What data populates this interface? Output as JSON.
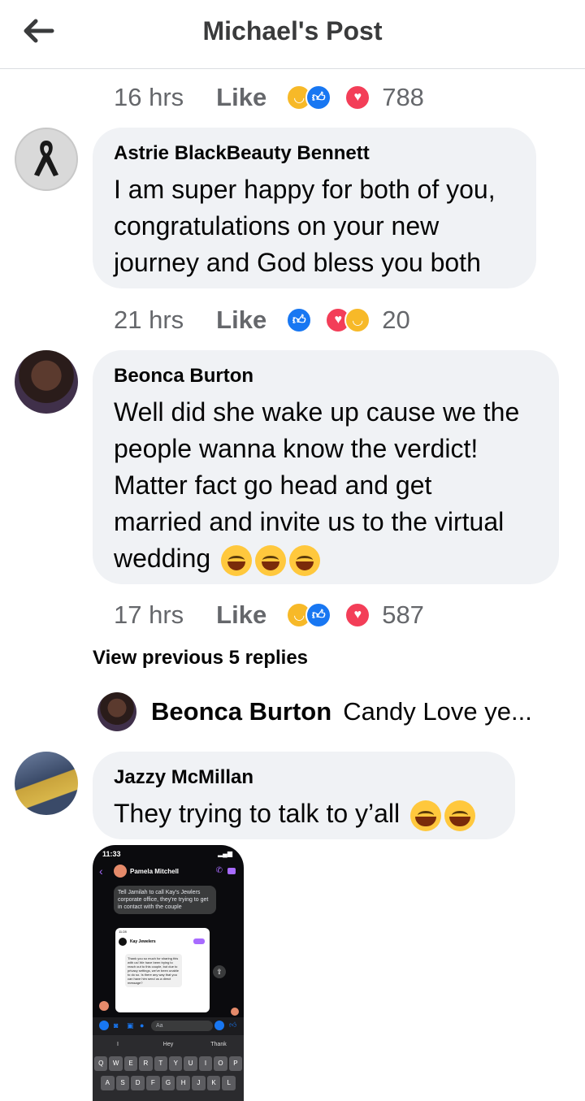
{
  "header": {
    "title": "Michael's Post"
  },
  "items": [
    {
      "time": "16 hrs",
      "like_label": "Like",
      "reaction_count": "788"
    },
    {
      "author": "Astrie BlackBeauty Bennett",
      "lines": [
        "I am super happy for both of you,",
        "congratulations on your new",
        "journey and God bless you both"
      ],
      "time": "21 hrs",
      "like_label": "Like",
      "reaction_count": "20"
    },
    {
      "author": "Beonca Burton",
      "lines": [
        "Well did she wake up cause we the",
        "people wanna know the verdict!",
        "Matter fact go head and get",
        "married and invite us to the virtual",
        "wedding"
      ],
      "time": "17 hrs",
      "like_label": "Like",
      "reaction_count": "587"
    }
  ],
  "view_previous": "View previous 5 replies",
  "reply_preview": {
    "name": "Beonca Burton",
    "text": "Candy Love  ye..."
  },
  "last_comment": {
    "author": "Jazzy McMillan",
    "text": "They trying to talk to y’all"
  },
  "attachment": {
    "status_time": "11:33",
    "contact": "Pamela Mitchell",
    "message": "Tell Jamilah to call Kay's Jewlers corporate office, they're trying to get in contact with the couple",
    "inner_time": "11:28",
    "inner_contact": "Kay Jewelers",
    "inner_message": "Thank you so much for sharing this with us! We have been trying to reach out to this couple, but due to privacy settings, we've been unable to do so. Is there any way that you can have him send us a direct message?",
    "composer_placeholder": "Aa",
    "suggestions": [
      "I",
      "Hey",
      "Thank"
    ],
    "kb_row1": [
      "Q",
      "W",
      "E",
      "R",
      "T",
      "Y",
      "U",
      "I",
      "O",
      "P"
    ],
    "kb_row2": [
      "A",
      "S",
      "D",
      "F",
      "G",
      "H",
      "J",
      "K",
      "L"
    ]
  },
  "colors": {
    "bubble": "#f0f2f5",
    "meta": "#65676b",
    "like_blue": "#1877f2",
    "love_red": "#f33e58",
    "haha_yellow": "#f7b928"
  }
}
